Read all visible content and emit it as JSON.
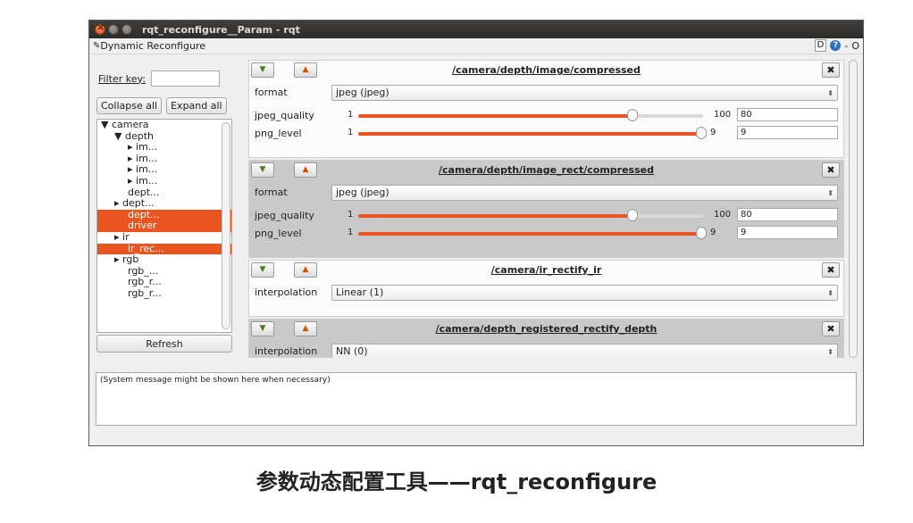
{
  "window": {
    "title": "rqt_reconfigure__Param - rqt"
  },
  "plugin": {
    "title": "Dynamic Reconfigure",
    "d_label": "D",
    "help_label": "?",
    "minus_label": "-",
    "o_label": "O"
  },
  "left": {
    "filter_label": "Filter key:",
    "filter_value": "",
    "collapse_label": "Collapse all",
    "expand_label": "Expand all",
    "refresh_label": "Refresh",
    "tree": [
      {
        "text": "▼ camera",
        "indent": 0,
        "selected": false
      },
      {
        "text": "▼ depth",
        "indent": 1,
        "selected": false
      },
      {
        "text": "▸ im...",
        "indent": 2,
        "selected": false
      },
      {
        "text": "▸ im...",
        "indent": 2,
        "selected": false
      },
      {
        "text": "▸ im...",
        "indent": 2,
        "selected": false
      },
      {
        "text": "▸ im...",
        "indent": 2,
        "selected": false
      },
      {
        "text": "dept...",
        "indent": 2,
        "selected": false
      },
      {
        "text": "▸ dept...",
        "indent": 1,
        "selected": false
      },
      {
        "text": "dept...",
        "indent": 2,
        "selected": true
      },
      {
        "text": "driver",
        "indent": 2,
        "selected": true
      },
      {
        "text": "▸ ir",
        "indent": 1,
        "selected": false
      },
      {
        "text": "ir_rec...",
        "indent": 2,
        "selected": true
      },
      {
        "text": "▸ rgb",
        "indent": 1,
        "selected": false
      },
      {
        "text": "rgb_...",
        "indent": 2,
        "selected": false
      },
      {
        "text": "rgb_r...",
        "indent": 2,
        "selected": false
      },
      {
        "text": "rgb_r...",
        "indent": 2,
        "selected": false
      }
    ]
  },
  "panels": [
    {
      "title": "/camera/depth/image/compressed",
      "style": "white",
      "format_label": "format",
      "format_value": "jpeg (jpeg)",
      "sliders": [
        {
          "label": "jpeg_quality",
          "min": "1",
          "max": "100",
          "value": "80",
          "fraction": 0.8
        },
        {
          "label": "png_level",
          "min": "1",
          "max": "9",
          "value": "9",
          "fraction": 1.0
        }
      ]
    },
    {
      "title": "/camera/depth/image_rect/compressed",
      "style": "gray",
      "format_label": "format",
      "format_value": "jpeg (jpeg)",
      "sliders": [
        {
          "label": "jpeg_quality",
          "min": "1",
          "max": "100",
          "value": "80",
          "fraction": 0.8
        },
        {
          "label": "png_level",
          "min": "1",
          "max": "9",
          "value": "9",
          "fraction": 1.0
        }
      ]
    },
    {
      "title": "/camera/ir_rectify_ir",
      "style": "white",
      "format_label": "interpolation",
      "format_value": "Linear (1)",
      "sliders": []
    },
    {
      "title": "/camera/depth_registered_rectify_depth",
      "style": "gray",
      "format_label": "interpolation",
      "format_value": "NN (0)",
      "sliders": []
    }
  ],
  "message": "(System message might be shown here when necessary)",
  "caption": "参数动态配置工具——rqt_reconfigure",
  "colors": {
    "accent": "#e95420"
  }
}
